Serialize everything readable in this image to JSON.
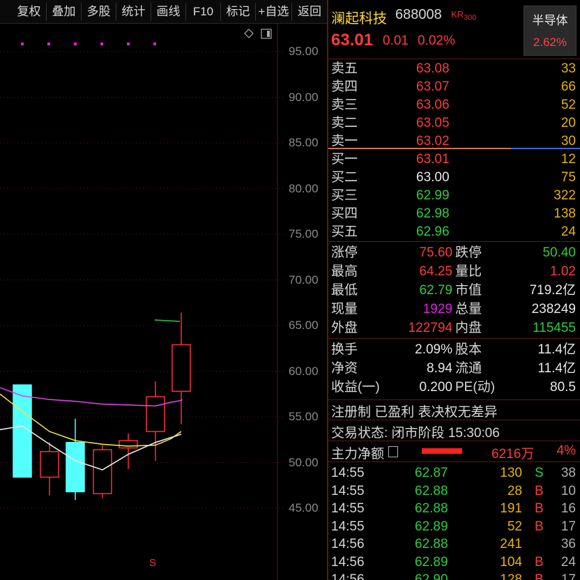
{
  "toolbar": {
    "buttons": [
      "复权",
      "叠加",
      "多股",
      "统计",
      "画线",
      "F10",
      "标记",
      "+自选",
      "返回"
    ]
  },
  "chart": {
    "y_ticks": [
      "95.00",
      "90.00",
      "85.00",
      "80.00",
      "75.00",
      "70.00",
      "65.00",
      "60.00",
      "55.00",
      "50.00",
      "45.00"
    ],
    "marker_label": "S",
    "candles": [
      {
        "open": 58.5,
        "close": 48.4,
        "high": 58.5,
        "low": 48.4,
        "color": "cyan"
      },
      {
        "open": 48.4,
        "close": 51.2,
        "high": 52.2,
        "low": 46.4,
        "color": "red"
      },
      {
        "open": 52.2,
        "close": 46.8,
        "high": 54.8,
        "low": 45.9,
        "color": "cyan"
      },
      {
        "open": 46.6,
        "close": 51.4,
        "high": 51.9,
        "low": 46.1,
        "color": "red"
      },
      {
        "open": 51.6,
        "close": 52.4,
        "high": 53.2,
        "low": 49.3,
        "color": "red"
      },
      {
        "open": 53.4,
        "close": 57.2,
        "high": 58.9,
        "low": 50.2,
        "color": "red"
      },
      {
        "open": 57.8,
        "close": 62.9,
        "high": 66.4,
        "low": 54.2,
        "color": "red"
      }
    ],
    "ma_series": [
      {
        "name": "MA-magenta",
        "color": "#e040e0",
        "values": [
          58.2,
          57.3,
          56.9,
          56.7,
          56.4,
          56.3,
          56.2,
          56.6,
          56.8,
          56.9
        ]
      },
      {
        "name": "MA-yellow",
        "color": "#f0e040",
        "values": [
          57.5,
          55.6,
          53.4,
          52.4,
          52.0,
          51.8,
          51.9,
          52.6,
          53.4
        ]
      },
      {
        "name": "MA-white",
        "color": "#e8e8e8",
        "values": [
          53.6,
          54.0,
          52.0,
          50.2,
          49.2,
          50.9,
          52.2,
          53.1
        ]
      }
    ]
  },
  "panel": {
    "name": "澜起科技",
    "code": "688008",
    "badge": "KR",
    "badge_sub": "300",
    "sector": "半导体",
    "sector_pct": "2.62%",
    "price": "63.01",
    "change": "0.01",
    "change_pct": "0.02%",
    "asks": [
      {
        "label": "卖五",
        "price": "63.08",
        "vol": "33"
      },
      {
        "label": "卖四",
        "price": "63.07",
        "vol": "66"
      },
      {
        "label": "卖三",
        "price": "63.06",
        "vol": "52"
      },
      {
        "label": "卖二",
        "price": "63.05",
        "vol": "20"
      },
      {
        "label": "卖一",
        "price": "63.02",
        "vol": "30"
      }
    ],
    "bids": [
      {
        "label": "买一",
        "price": "63.01",
        "vol": "12",
        "color": "red"
      },
      {
        "label": "买二",
        "price": "63.00",
        "vol": "75",
        "color": "white"
      },
      {
        "label": "买三",
        "price": "62.99",
        "vol": "322",
        "color": "green"
      },
      {
        "label": "买四",
        "price": "62.98",
        "vol": "138",
        "color": "green"
      },
      {
        "label": "买五",
        "price": "62.96",
        "vol": "24",
        "color": "green"
      }
    ],
    "stats1": [
      {
        "l1": "涨停",
        "v1": "75.60",
        "c1": "red",
        "l2": "跌停",
        "v2": "50.40",
        "c2": "green"
      },
      {
        "l1": "最高",
        "v1": "64.25",
        "c1": "red",
        "l2": "量比",
        "v2": "1.02",
        "c2": "red"
      },
      {
        "l1": "最低",
        "v1": "62.79",
        "c1": "green",
        "l2": "市值",
        "v2": "719.2亿",
        "c2": "white"
      },
      {
        "l1": "现量",
        "v1": "1929",
        "c1": "magenta",
        "l2": "总量",
        "v2": "238249",
        "c2": "white"
      },
      {
        "l1": "外盘",
        "v1": "122794",
        "c1": "red",
        "l2": "内盘",
        "v2": "115455",
        "c2": "green"
      }
    ],
    "stats2": [
      {
        "l1": "换手",
        "v1": "2.09%",
        "c1": "white",
        "l2": "股本",
        "v2": "11.4亿",
        "c2": "white"
      },
      {
        "l1": "净资",
        "v1": "8.94",
        "c1": "white",
        "l2": "流通",
        "v2": "11.4亿",
        "c2": "white"
      },
      {
        "l1": "收益(一)",
        "v1": "0.200",
        "c1": "white",
        "l2": "PE(动)",
        "v2": "80.5",
        "c2": "white"
      }
    ],
    "tags": "注册制 已盈利 表决权无差异",
    "trade_status": "交易状态: 闭市阶段 15:30:06",
    "main_flow_label": "主力净额",
    "main_flow_value": "6216万",
    "main_flow_pct": "4%",
    "ticks": [
      {
        "t": "14:55",
        "p": "62.87",
        "pc": "green",
        "v": "130",
        "bs": "S",
        "bc": "green",
        "n": "38"
      },
      {
        "t": "14:55",
        "p": "62.88",
        "pc": "green",
        "v": "28",
        "bs": "B",
        "bc": "red",
        "n": "10"
      },
      {
        "t": "14:55",
        "p": "62.88",
        "pc": "green",
        "v": "191",
        "bs": "B",
        "bc": "red",
        "n": "16"
      },
      {
        "t": "14:55",
        "p": "62.89",
        "pc": "green",
        "v": "52",
        "bs": "B",
        "bc": "red",
        "n": "17"
      },
      {
        "t": "14:56",
        "p": "62.88",
        "pc": "green",
        "v": "241",
        "bs": "",
        "bc": "red",
        "n": "36"
      },
      {
        "t": "14:56",
        "p": "62.89",
        "pc": "green",
        "v": "104",
        "bs": "B",
        "bc": "red",
        "n": "24"
      },
      {
        "t": "14:56",
        "p": "62.90",
        "pc": "green",
        "v": "128",
        "bs": "B",
        "bc": "red",
        "n": "17"
      }
    ]
  }
}
